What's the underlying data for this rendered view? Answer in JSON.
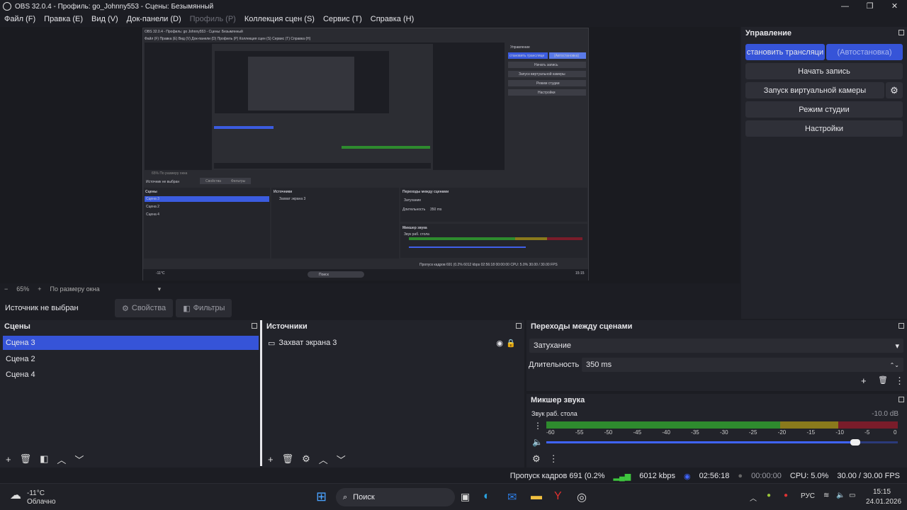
{
  "window": {
    "title": "OBS 32.0.4 - Профиль: go_Johnny553 - Сцены: Безымянный",
    "minimize": "—",
    "maximize": "❐",
    "close": "✕"
  },
  "menu": {
    "file": "Файл (F)",
    "edit": "Правка (E)",
    "view": "Вид (V)",
    "docks": "Док-панели (D)",
    "profile": "Профиль (P)",
    "scene_collection": "Коллекция сцен (S)",
    "tools": "Сервис (T)",
    "help": "Справка (H)"
  },
  "zoom": {
    "minus": "−",
    "value": "65%",
    "plus": "+",
    "fit": "По размеру окна"
  },
  "source_bar": {
    "no_source": "Источник не выбран",
    "properties": "Свойства",
    "filters": "Фильтры"
  },
  "controls": {
    "title": "Управление",
    "stream": "становить трансляци",
    "auto_stop": "(Автостановка)",
    "record": "Начать запись",
    "virtual_cam": "Запуск виртуальной камеры",
    "studio_mode": "Режим студии",
    "settings": "Настройки"
  },
  "scenes": {
    "title": "Сцены",
    "items": [
      "Сцена 3",
      "Сцена 2",
      "Сцена 4"
    ]
  },
  "sources": {
    "title": "Источники",
    "items": [
      "Захват экрана 3"
    ]
  },
  "transitions": {
    "title": "Переходы между сценами",
    "type": "Затухание",
    "duration_label": "Длительность",
    "duration_value": "350 ms"
  },
  "mixer": {
    "title": "Микшер звука",
    "channel": "Звук раб. стола",
    "level": "-10.0 dB",
    "volume_fraction": 0.88,
    "ticks": [
      "-60",
      "-55",
      "-50",
      "-45",
      "-40",
      "-35",
      "-30",
      "-25",
      "-20",
      "-15",
      "-10",
      "-5",
      "0"
    ]
  },
  "status": {
    "dropped": "Пропуск кадров 691 (0.2%",
    "bitrate": "6012 kbps",
    "stream_time": "02:56:18",
    "rec_time": "00:00:00",
    "cpu": "CPU: 5.0%",
    "fps": "30.00 / 30.00 FPS"
  },
  "taskbar": {
    "weather_temp": "-11°C",
    "weather_desc": "Облачно",
    "search": "Поиск",
    "lang": "РУС",
    "time": "15:15",
    "date": "24.01.2026"
  },
  "mini_preview": {
    "title": "OBS 32.0.4 - Профиль: go Johnny553 - Сцены: Безымянный",
    "menu": "Файл (F)   Правка (E)   Вид (V)   Док-панели (D)   Профиль (P)   Коллекция сцен (S)   Сервис (T)   Справка (H)",
    "controls": "Управление",
    "stream": "становить трансляци",
    "auto": "(Автостановка)",
    "record": "Начать запись",
    "vcam": "Запуск виртуальной камеры",
    "studio": "Режим студии",
    "settings": "Настройки",
    "zoom": "65%   По размеру окна",
    "nosrc": "Источник не выбран",
    "props": "Свойства",
    "filters": "Фильтры",
    "scenes": "Сцены",
    "scene3": "Сцена 3",
    "scene2": "Сцена 2",
    "scene4": "Сцена 4",
    "sources": "Источники",
    "src1": "Захват экрана 3",
    "transitions": "Переходы между сценами",
    "fade": "Затухание",
    "duration": "Длительность",
    "dur_val": "350 ms",
    "mixer": "Микшер звука",
    "desk": "Звук раб. стола",
    "status": "Пропуск кадров 691 (0.2%   6012 kbps   02:56:18   00:00:00   CPU: 5.0%   30.00 / 30.00 FPS",
    "weather": "-11°C",
    "search": "Поиск",
    "clock": "15:15"
  }
}
